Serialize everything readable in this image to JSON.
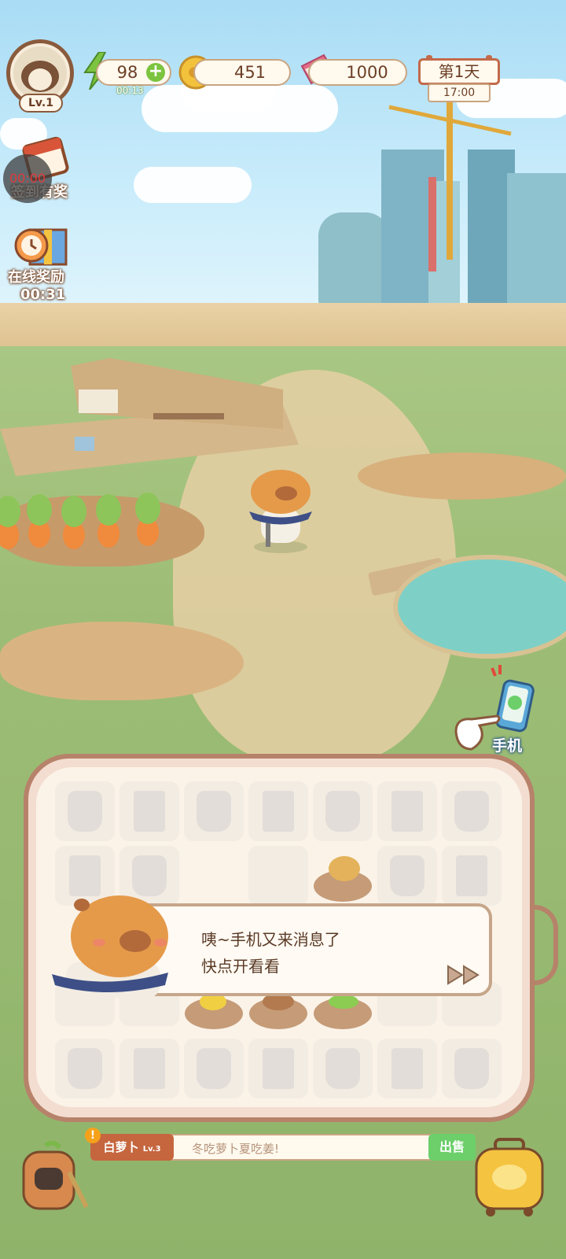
{
  "player": {
    "level": "Lv.1"
  },
  "resources": {
    "energy": {
      "value": "98",
      "timer": "00:13"
    },
    "coins": {
      "value": "451"
    },
    "tickets": {
      "value": "1000"
    }
  },
  "calendar": {
    "day": "第1天",
    "time": "17:00"
  },
  "side_buttons": {
    "checkin": {
      "label": "签到有奖",
      "record_timer": "00:00"
    },
    "online_reward": {
      "label": "在线奖励",
      "timer": "00:31"
    }
  },
  "phone": {
    "label": "手机"
  },
  "dialog": {
    "lines": [
      "咦~手机又来消息了",
      "快点开看看"
    ]
  },
  "selected_item": {
    "name": "白萝卜",
    "level": "Lv.3",
    "description": "冬吃萝卜夏吃姜!",
    "sell_label": "出售",
    "alert": "!"
  },
  "colors": {
    "accent_brown": "#8a5a3c",
    "sell_green": "#6ccf6a",
    "tag_orange": "#c5663e",
    "energy_green": "#7cc43f",
    "coin_gold": "#f3c23c"
  }
}
